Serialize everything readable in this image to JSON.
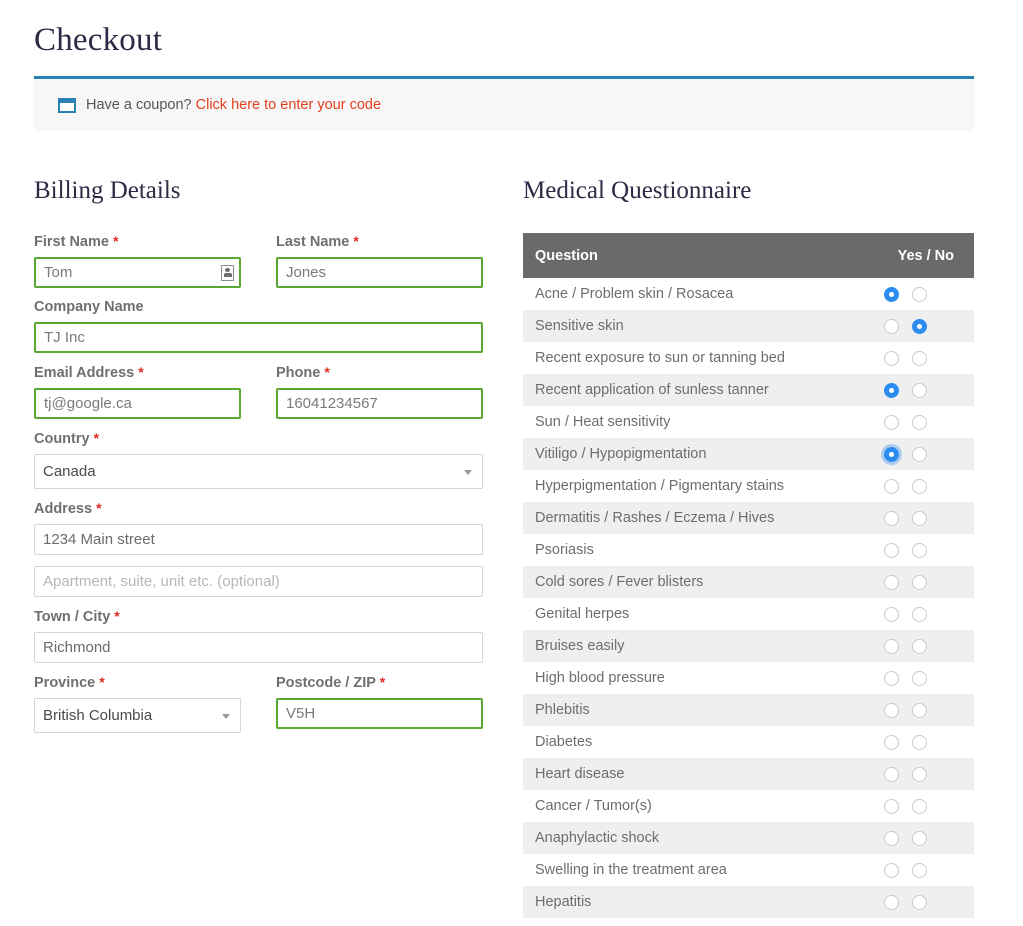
{
  "page": {
    "title": "Checkout"
  },
  "coupon": {
    "icon": "coupon-tag-icon",
    "prompt": "Have a coupon?",
    "link_text": "Click here to enter your code",
    "link_color": "#e2401c",
    "top_border_color": "#2a81b5"
  },
  "billing": {
    "title": "Billing Details",
    "required_mark": "*",
    "fields": {
      "first_name": {
        "label": "First Name",
        "required": true,
        "value": "Tom",
        "placeholder": "",
        "state": "valid"
      },
      "last_name": {
        "label": "Last Name",
        "required": true,
        "value": "Jones",
        "placeholder": "",
        "state": "valid"
      },
      "company": {
        "label": "Company Name",
        "required": false,
        "value": "TJ Inc",
        "placeholder": "",
        "state": "valid"
      },
      "email": {
        "label": "Email Address",
        "required": true,
        "value": "tj@google.ca",
        "placeholder": "",
        "state": "valid"
      },
      "phone": {
        "label": "Phone",
        "required": true,
        "value": "16041234567",
        "placeholder": "",
        "state": "valid"
      },
      "country": {
        "label": "Country",
        "required": true,
        "value": "Canada"
      },
      "address1": {
        "label": "Address",
        "required": true,
        "value": "1234 Main street",
        "placeholder": "",
        "state": "normal"
      },
      "address2": {
        "label": "",
        "required": false,
        "value": "",
        "placeholder": "Apartment, suite, unit etc. (optional)",
        "state": "normal"
      },
      "city": {
        "label": "Town / City",
        "required": true,
        "value": "Richmond",
        "placeholder": "",
        "state": "normal"
      },
      "province": {
        "label": "Province",
        "required": true,
        "value": "British Columbia"
      },
      "postcode": {
        "label": "Postcode / ZIP",
        "required": true,
        "value": "V5H",
        "placeholder": "",
        "state": "valid"
      }
    }
  },
  "questionnaire": {
    "title": "Medical Questionnaire",
    "columns": [
      "Question",
      "Yes / No"
    ],
    "header_bg": "#6b6a6a",
    "selected_color": "#2d8cf0",
    "rows": [
      {
        "question": "Acne / Problem skin / Rosacea",
        "answer": "yes",
        "focused": false
      },
      {
        "question": "Sensitive skin",
        "answer": "no",
        "focused": false
      },
      {
        "question": "Recent exposure to sun or tanning bed",
        "answer": null,
        "focused": false
      },
      {
        "question": "Recent application of sunless tanner",
        "answer": "yes",
        "focused": false
      },
      {
        "question": "Sun / Heat sensitivity",
        "answer": null,
        "focused": false
      },
      {
        "question": "Vitiligo / Hypopigmentation",
        "answer": "yes",
        "focused": true
      },
      {
        "question": "Hyperpigmentation / Pigmentary stains",
        "answer": null,
        "focused": false
      },
      {
        "question": "Dermatitis / Rashes / Eczema / Hives",
        "answer": null,
        "focused": false
      },
      {
        "question": "Psoriasis",
        "answer": null,
        "focused": false
      },
      {
        "question": "Cold sores / Fever blisters",
        "answer": null,
        "focused": false
      },
      {
        "question": "Genital herpes",
        "answer": null,
        "focused": false
      },
      {
        "question": "Bruises easily",
        "answer": null,
        "focused": false
      },
      {
        "question": "High blood pressure",
        "answer": null,
        "focused": false
      },
      {
        "question": "Phlebitis",
        "answer": null,
        "focused": false
      },
      {
        "question": "Diabetes",
        "answer": null,
        "focused": false
      },
      {
        "question": "Heart disease",
        "answer": null,
        "focused": false
      },
      {
        "question": "Cancer / Tumor(s)",
        "answer": null,
        "focused": false
      },
      {
        "question": "Anaphylactic shock",
        "answer": null,
        "focused": false
      },
      {
        "question": "Swelling in the treatment area",
        "answer": null,
        "focused": false
      },
      {
        "question": "Hepatitis",
        "answer": null,
        "focused": false
      }
    ]
  }
}
